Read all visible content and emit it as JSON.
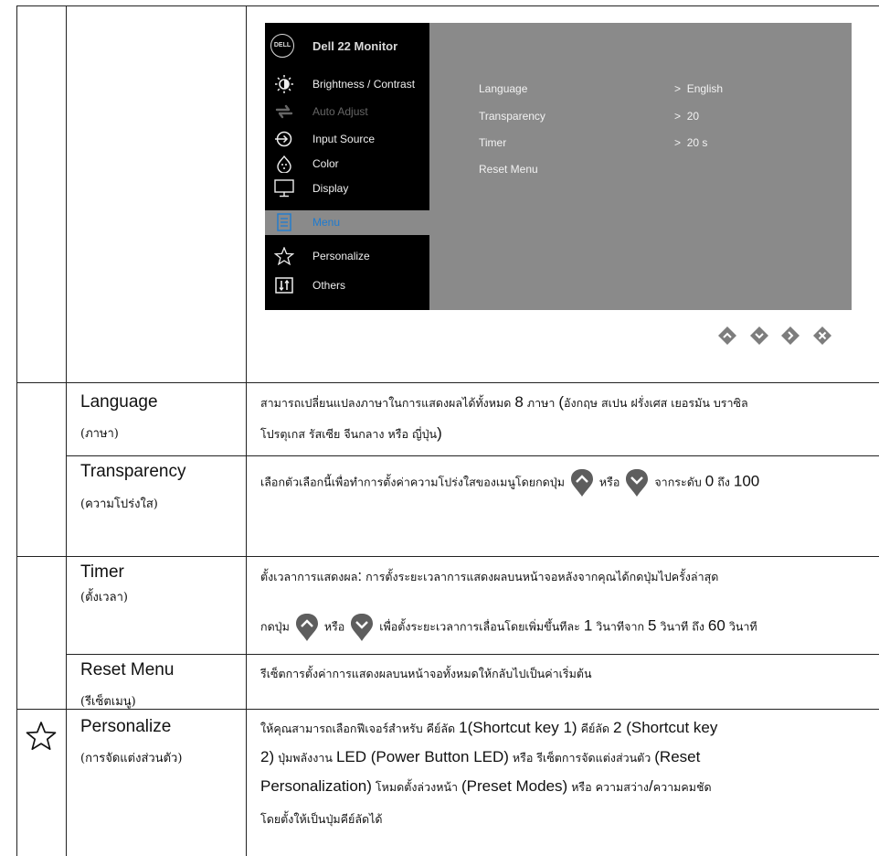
{
  "osd": {
    "title": "Dell 22 Monitor",
    "logo_text": "DELL",
    "menu_items": [
      {
        "label": "Brightness / Contrast",
        "icon": "brightness-icon",
        "state": "normal"
      },
      {
        "label": "Auto Adjust",
        "icon": "auto-adjust-icon",
        "state": "disabled"
      },
      {
        "label": "Input Source",
        "icon": "input-source-icon",
        "state": "normal"
      },
      {
        "label": "Color",
        "icon": "color-icon",
        "state": "normal"
      },
      {
        "label": "Display",
        "icon": "display-icon",
        "state": "normal"
      },
      {
        "label": "Menu",
        "icon": "menu-icon",
        "state": "selected"
      },
      {
        "label": "Personalize",
        "icon": "star-icon",
        "state": "normal"
      },
      {
        "label": "Others",
        "icon": "others-icon",
        "state": "normal"
      }
    ],
    "options": [
      {
        "label": "Language",
        "value": "English"
      },
      {
        "label": "Transparency",
        "value": "20"
      },
      {
        "label": "Timer",
        "value": "20 s"
      },
      {
        "label": "Reset Menu",
        "value": ""
      }
    ],
    "value_prefix": ">",
    "panel_color": "#8a8a8a",
    "selected_color": "#1e7bd0"
  },
  "nav_buttons": [
    "up-icon",
    "down-icon",
    "right-icon",
    "close-icon"
  ],
  "rows": {
    "language": {
      "name_en": "Language",
      "name_th": "(ภาษา)",
      "line1_a": "สามารถเปลี่ยนแปลงภาษาในการแสดงผลได้ทั้งหมด",
      "line1_num": "8",
      "line1_b": "ภาษา",
      "line1_paren_open": "(",
      "line1_c": "อังกฤษ สเปน ฝรั่งเศส เยอรมัน บราซิล",
      "line2": "โปรตุเกส รัสเซีย จีนกลาง หรือ ญี่ปุ่น",
      "line2_paren_close": ")"
    },
    "transparency": {
      "name_en": "Transparency",
      "name_th": "(ความโปร่งใส)",
      "text_a": "เลือกตัวเลือกนี้เพื่อทำการตั้งค่าความโปร่งใสของเมนูโดยกดปุ่ม",
      "text_or": "หรือ",
      "text_b": "จากระดับ",
      "min": "0",
      "text_to": "ถึง",
      "max": "100"
    },
    "timer": {
      "name_en": "Timer",
      "name_th": "(ตั้งเวลา)",
      "line1_a": "ตั้งเวลาการแสดงผล",
      "line1_colon": ":",
      "line1_b": "การตั้งระยะเวลาการแสดงผลบนหน้าจอหลังจากคุณได้กดปุ่มไปครั้งล่าสุด",
      "line2_a": "กดปุ่ม",
      "line2_or": "หรือ",
      "line2_b": "เพื่อตั้งระยะเวลาการเลื่อนโดยเพิ่มขึ้นทีละ",
      "step": "1",
      "line2_c": "วินาทีจาก",
      "min": "5",
      "line2_d": "วินาที ถึง",
      "max": "60",
      "line2_e": "วินาที"
    },
    "reset_menu": {
      "name_en": "Reset Menu",
      "name_th": "(รีเซ็ตเมนู)",
      "text": "รีเซ็ตการตั้งค่าการแสดงผลบนหน้าจอทั้งหมดให้กลับไปเป็นค่าเริ่มต้น"
    },
    "personalize": {
      "name_en": "Personalize",
      "name_th": "(การจัดแต่งส่วนตัว)",
      "l1_a": "ให้คุณสามารถเลือกฟีเจอร์สำหรับ คีย์ลัด",
      "l1_b": "1(Shortcut key 1)",
      "l1_c": "คีย์ลัด",
      "l1_d": "2 (Shortcut key",
      "l2_a": "2)",
      "l2_b": "ปุ่มพลังงาน",
      "l2_c": "LED (Power Button LED)",
      "l2_d": "หรือ รีเซ็ตการจัดแต่งส่วนตัว",
      "l2_e": "(Reset",
      "l3_a": "Personalization)",
      "l3_b": "โหมดตั้งล่วงหน้า",
      "l3_c": "(Preset Modes)",
      "l3_d": "หรือ ความสว่าง",
      "l3_e": "/",
      "l3_f": "ความคมชัด",
      "l4": "โดยตั้งให้เป็นปุ่มคีย์ลัดได้"
    }
  }
}
